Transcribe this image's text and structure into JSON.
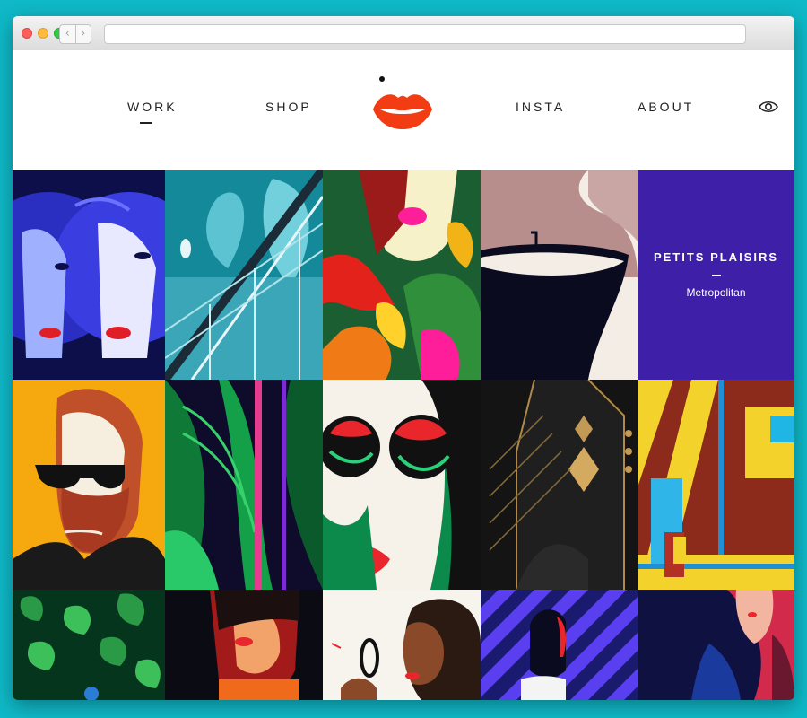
{
  "browser": {
    "back_glyph": "‹",
    "forward_glyph": "›"
  },
  "nav": {
    "work": "WORK",
    "shop": "SHOP",
    "insta": "INSTA",
    "about": "ABOUT"
  },
  "icons": {
    "logo": "lips-logo",
    "view_toggle": "eye-icon"
  },
  "promo": {
    "title": "PETITS PLAISIRS",
    "subtitle": "Metropolitan"
  },
  "colors": {
    "background": "#0fb9c8",
    "logo_red": "#f23d14",
    "promo_purple": "#3d1fa8"
  }
}
